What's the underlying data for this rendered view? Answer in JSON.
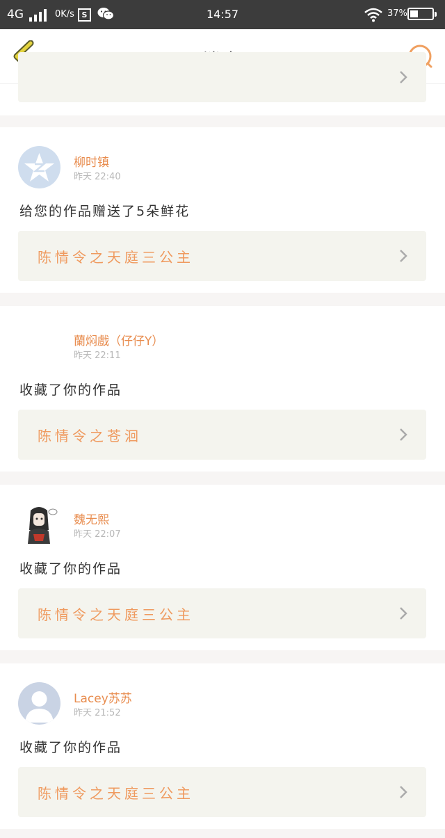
{
  "status_bar": {
    "network": "4G",
    "speed": "0K/s",
    "time": "14:57",
    "battery": "37%",
    "battery_level": 0.37
  },
  "header": {
    "title": "消息"
  },
  "messages": [
    {
      "name": "柳时镇",
      "time": "昨天 22:40",
      "text": "给您的作品赠送了5朵鲜花",
      "work": "陈情令之天庭三公主",
      "avatar": "qzone-avatar"
    },
    {
      "name": "蘭焖戲（仔仔Y）",
      "time": "昨天 22:11",
      "text": "收藏了你的作品",
      "work": "陈情令之苍洄",
      "avatar": "blank-avatar"
    },
    {
      "name": "魏无熙",
      "time": "昨天 22:07",
      "text": "收藏了你的作品",
      "work": "陈情令之天庭三公主",
      "avatar": "anime-character-avatar"
    },
    {
      "name": "Lacey苏苏",
      "time": "昨天 21:52",
      "text": "收藏了你的作品",
      "work": "陈情令之天庭三公主",
      "avatar": "default-person-avatar"
    }
  ],
  "colors": {
    "accent": "#e88c4e",
    "work_title": "#ef9a5f",
    "work_bg": "#f4f4ee",
    "back_arrow": "#d9c63a",
    "search": "#f0a060"
  }
}
